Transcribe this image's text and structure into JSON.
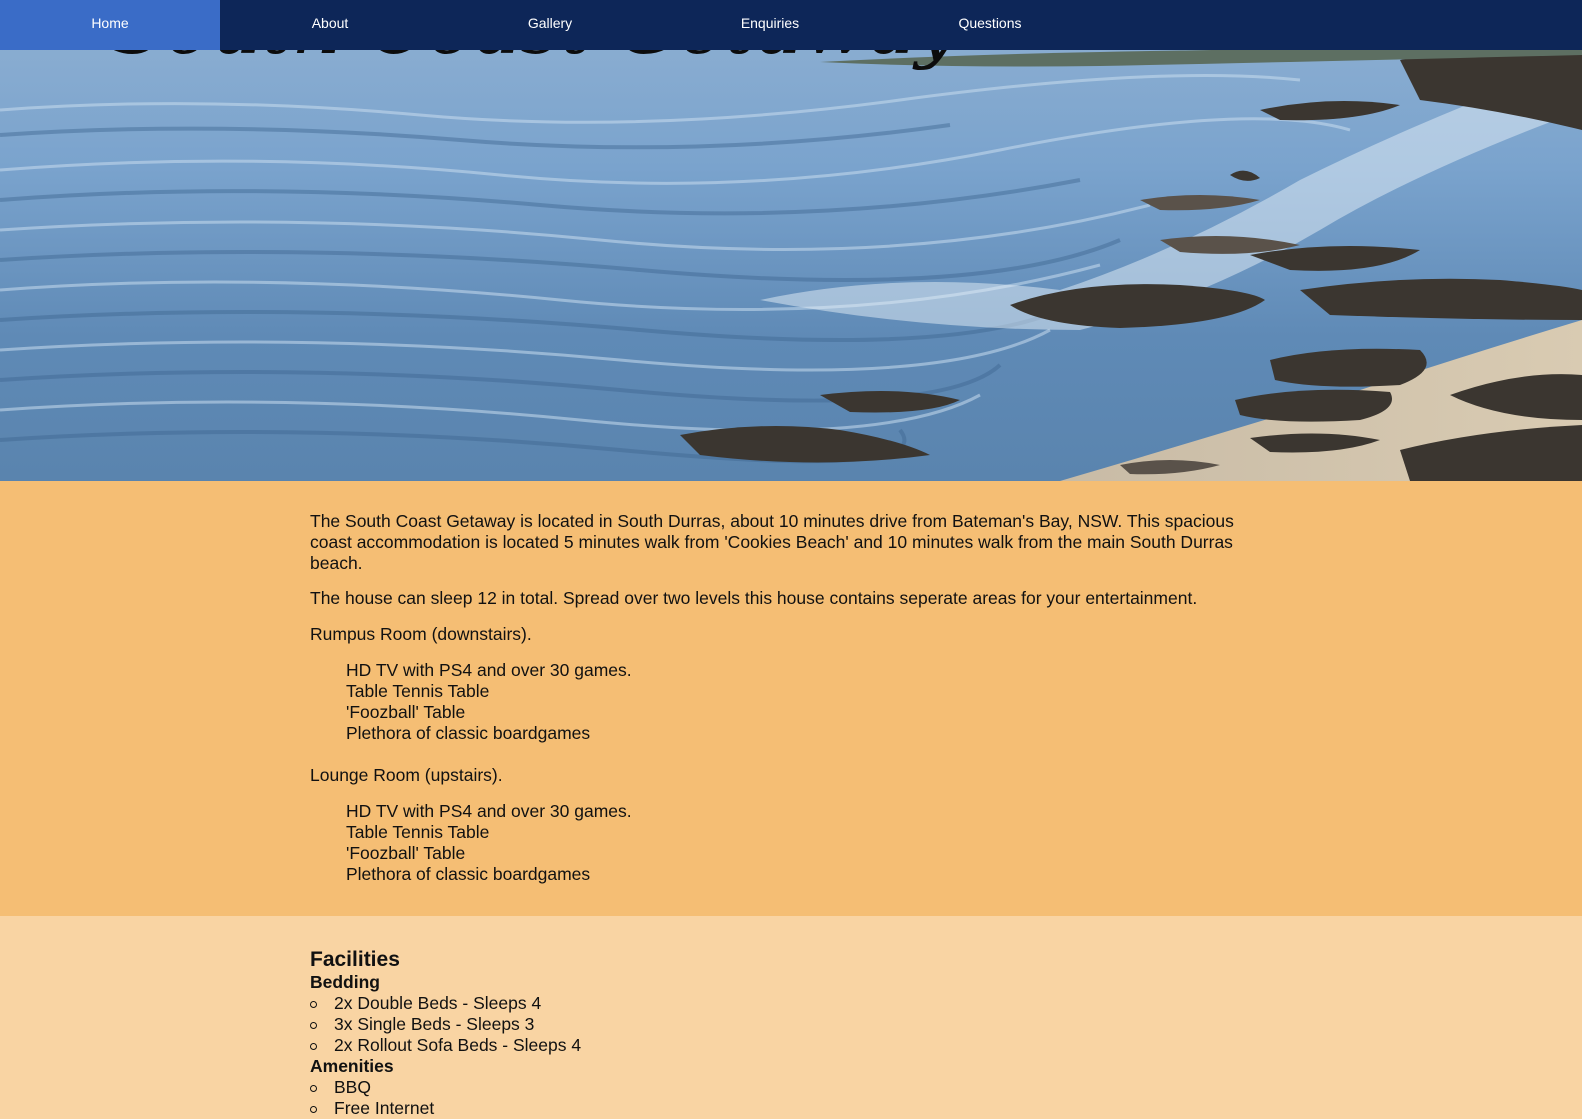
{
  "nav": {
    "items": [
      {
        "label": "Home",
        "active": true
      },
      {
        "label": "About",
        "active": false
      },
      {
        "label": "Gallery",
        "active": false
      },
      {
        "label": "Enquiries",
        "active": false
      },
      {
        "label": "Questions",
        "active": false
      }
    ],
    "background": "#0d2658",
    "active_color": "#3a6cc7"
  },
  "hero": {
    "title": "South Coast Getaway"
  },
  "intro": {
    "paragraph1": "The South Coast Getaway is located in South Durras, about 10 minutes drive from Bateman's Bay, NSW. This spacious coast accommodation is located 5 minutes walk from 'Cookies Beach' and 10 minutes walk from the main South Durras beach.",
    "paragraph2": "The house can sleep 12 in total. Spread over two levels this house contains seperate areas for your entertainment.",
    "rooms": [
      {
        "name": "Rumpus Room (downstairs).",
        "items": [
          "HD TV with PS4 and over 30 games.",
          "Table Tennis Table",
          "'Foozball' Table",
          "Plethora of classic boardgames"
        ]
      },
      {
        "name": "Lounge Room (upstairs).",
        "items": [
          "HD TV with PS4 and over 30 games.",
          "Table Tennis Table",
          "'Foozball' Table",
          "Plethora of classic boardgames"
        ]
      }
    ],
    "background": "#f5be74"
  },
  "facilities": {
    "heading": "Facilities",
    "bedding_label": "Bedding",
    "bedding": [
      "2x Double Beds - Sleeps 4",
      "3x Single Beds - Sleeps 3",
      "2x Rollout Sofa Beds - Sleeps 4"
    ],
    "amenities_label": "Amenities",
    "amenities": [
      "BBQ",
      "Free Internet"
    ],
    "background": "#f9d4a3"
  }
}
